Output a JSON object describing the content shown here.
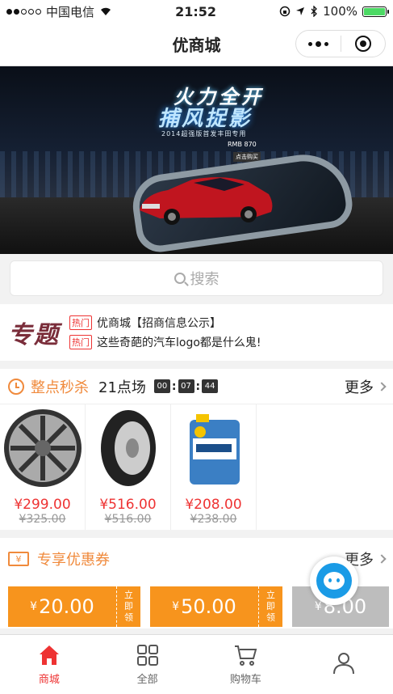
{
  "status_bar": {
    "carrier": "中国电信",
    "time": "21:52",
    "battery_text": "100%",
    "battery_level": 1.0
  },
  "nav": {
    "title": "优商城"
  },
  "banner": {
    "headline1": "火力全开",
    "headline2": "捕风捉影",
    "subline": "2014超强版首发丰田专用",
    "price": "RMB 870",
    "buy": "点击购买"
  },
  "search": {
    "placeholder": "搜索"
  },
  "topic": {
    "logo": "专题",
    "items": [
      {
        "tag": "热门",
        "text": "优商城【招商信息公示】"
      },
      {
        "tag": "热门",
        "text": "这些奇葩的汽车logo都是什么鬼!"
      }
    ]
  },
  "flash_sale": {
    "title": "整点秒杀",
    "slot": "21点场",
    "countdown": [
      "00",
      "07",
      "44"
    ],
    "more": "更多",
    "products": [
      {
        "name": "wheel-rim",
        "price": "¥299.00",
        "old_price": "¥325.00"
      },
      {
        "name": "tire",
        "price": "¥516.00",
        "old_price": "¥516.00"
      },
      {
        "name": "engine-oil",
        "price": "¥208.00",
        "old_price": "¥238.00"
      }
    ]
  },
  "coupons": {
    "title": "专享优惠券",
    "more": "更多",
    "items": [
      {
        "currency": "¥",
        "amount": "20.00",
        "action": "立即领"
      },
      {
        "currency": "¥",
        "amount": "50.00",
        "action": "立即领"
      },
      {
        "currency": "¥",
        "amount": "8.00",
        "action": ""
      }
    ]
  },
  "tabbar": {
    "tabs": [
      {
        "label": "商城",
        "icon": "home-icon",
        "active": true
      },
      {
        "label": "全部",
        "icon": "grid-icon",
        "active": false
      },
      {
        "label": "购物车",
        "icon": "cart-icon",
        "active": false
      },
      {
        "label": "",
        "icon": "user-icon",
        "active": false
      }
    ]
  },
  "colors": {
    "accent_orange": "#f08a3c",
    "price_red": "#e33333",
    "topic_logo": "#7a2d3a",
    "service_blue": "#1a9be6"
  }
}
